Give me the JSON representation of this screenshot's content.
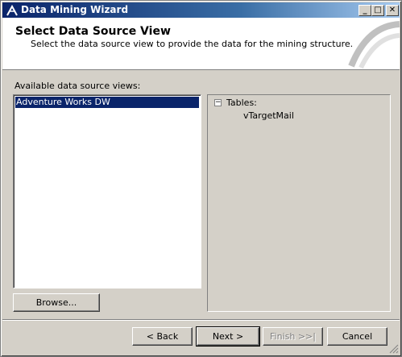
{
  "window": {
    "title": "Data Mining Wizard",
    "controls": {
      "minimize": "_",
      "maximize": "□",
      "close": "✕"
    }
  },
  "header": {
    "title": "Select Data Source View",
    "subtitle": "Select the data source view to provide the data for the mining structure."
  },
  "left_panel": {
    "label": "Available data source views:",
    "items": [
      "Adventure Works DW"
    ],
    "browse_label": "Browse..."
  },
  "right_panel": {
    "tree_root": "Tables:",
    "tree_toggle": "−",
    "tree_children": [
      "vTargetMail"
    ]
  },
  "footer": {
    "back": "< Back",
    "next": "Next >",
    "finish": "Finish >>|",
    "cancel": "Cancel"
  },
  "colors": {
    "title_bar": "#0a246a",
    "selection": "#0a246a",
    "face": "#d4d0c8"
  }
}
